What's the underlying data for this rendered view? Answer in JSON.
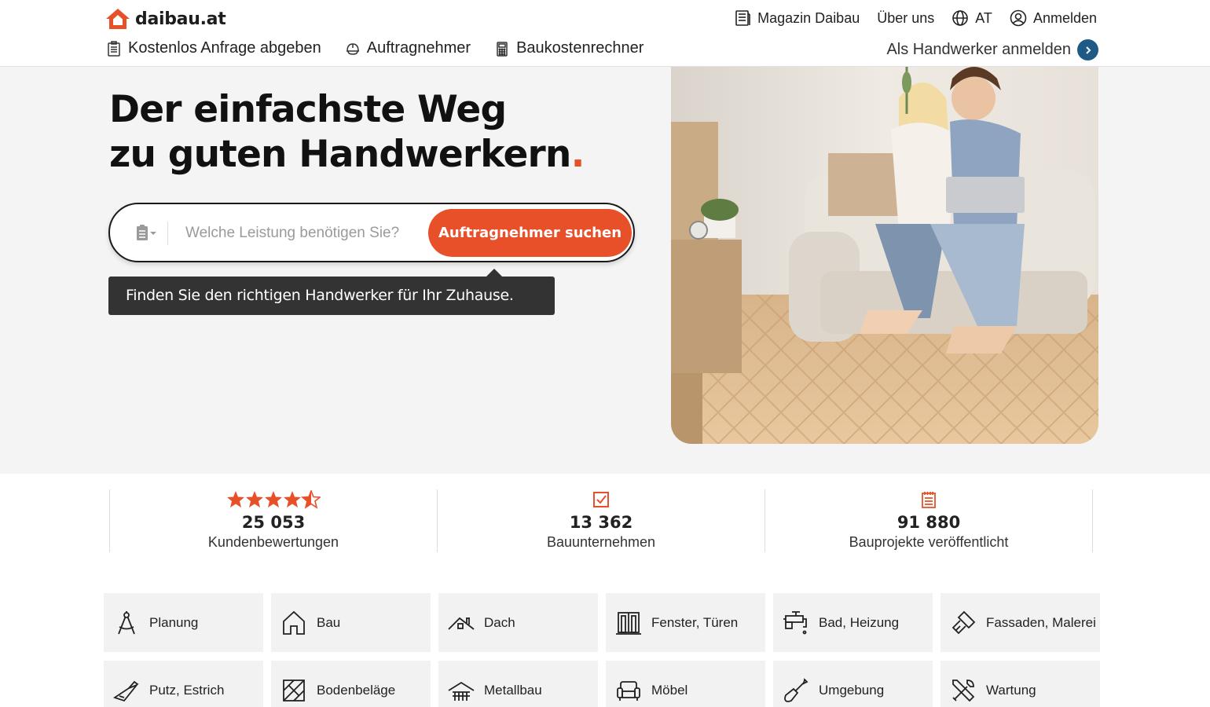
{
  "brand": {
    "name": "daibau.at",
    "accent": "#e8502a",
    "dark_blue": "#1f5a86"
  },
  "header": {
    "top_links": [
      {
        "label": "Magazin Daibau",
        "icon": "newspaper-icon"
      },
      {
        "label": "Über uns",
        "icon": ""
      },
      {
        "label": "AT",
        "icon": "globe-icon"
      },
      {
        "label": "Anmelden",
        "icon": "user-icon"
      }
    ],
    "nav": [
      {
        "label": "Kostenlos Anfrage abgeben",
        "icon": "clipboard-icon"
      },
      {
        "label": "Auftragnehmer",
        "icon": "hardhat-icon"
      },
      {
        "label": "Baukostenrechner",
        "icon": "calculator-icon"
      }
    ],
    "contractor_login": "Als Handwerker anmelden"
  },
  "hero": {
    "title_line1": "Der einfachste Weg",
    "title_line2": "zu guten Handwerkern",
    "title_dot": ".",
    "search_placeholder": "Welche Leistung benötigen Sie?",
    "search_button": "Auftragnehmer suchen",
    "tooltip": "Finden Sie den richtigen Handwerker für Ihr Zuhause."
  },
  "stats": [
    {
      "value": "25 053",
      "label": "Kundenbewertungen",
      "icon": "star-rating-icon",
      "rating": 4.5
    },
    {
      "value": "13 362",
      "label": "Bauunternehmen",
      "icon": "checkbox-icon"
    },
    {
      "value": "91 880",
      "label": "Bauprojekte veröffentlicht",
      "icon": "notepad-icon"
    }
  ],
  "categories": [
    {
      "label": "Planung",
      "icon": "compass-icon"
    },
    {
      "label": "Bau",
      "icon": "house-icon"
    },
    {
      "label": "Dach",
      "icon": "roof-icon"
    },
    {
      "label": "Fenster, Türen",
      "icon": "window-icon"
    },
    {
      "label": "Bad, Heizung",
      "icon": "faucet-icon"
    },
    {
      "label": "Fassaden, Malerei",
      "icon": "paint-roller-icon"
    },
    {
      "label": "Putz, Estrich",
      "icon": "trowel-icon"
    },
    {
      "label": "Bodenbeläge",
      "icon": "floor-tiles-icon"
    },
    {
      "label": "Metallbau",
      "icon": "metal-roof-icon"
    },
    {
      "label": "Möbel",
      "icon": "sofa-icon"
    },
    {
      "label": "Umgebung",
      "icon": "shovel-icon"
    },
    {
      "label": "Wartung",
      "icon": "tools-icon"
    }
  ]
}
